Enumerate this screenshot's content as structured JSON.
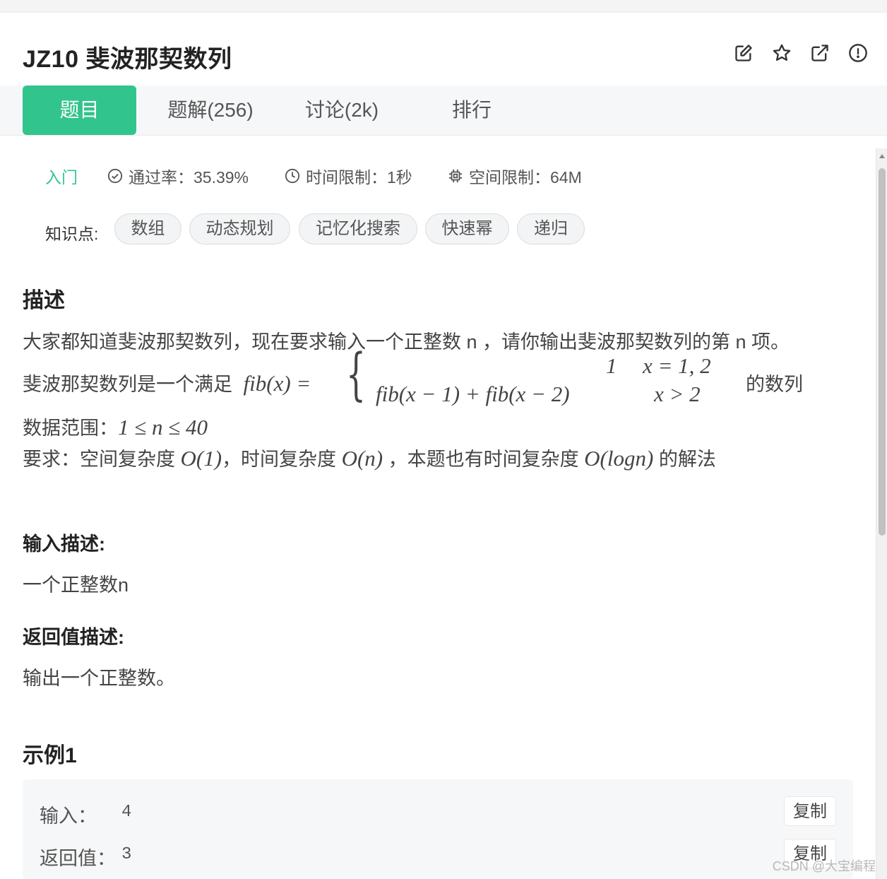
{
  "header": {
    "title": "JZ10  斐波那契数列",
    "icons": [
      "edit-icon",
      "star-icon",
      "share-icon",
      "report-icon"
    ]
  },
  "tabs": [
    {
      "label": "题目",
      "active": true
    },
    {
      "label": "题解(256)",
      "active": false
    },
    {
      "label": "讨论(2k)",
      "active": false
    },
    {
      "label": "排行",
      "active": false
    }
  ],
  "meta": {
    "level": "入门",
    "pass_rate": "通过率：35.39%",
    "time_limit": "时间限制：1秒",
    "space_limit": "空间限制：64M"
  },
  "knowledge": {
    "label": "知识点:",
    "tags": [
      "数组",
      "动态规划",
      "记忆化搜索",
      "快速幂",
      "递归"
    ]
  },
  "description": {
    "heading": "描述",
    "line1": "大家都知道斐波那契数列，现在要求输入一个正整数 n ，请你输出斐波那契数列的第 n 项。",
    "line2_prefix": "斐波那契数列是一个满足",
    "line2_fx": "fib(x) =",
    "case1_value": "1",
    "case1_cond": "x = 1, 2",
    "case2_value": "fib(x − 1) + fib(x − 2)",
    "case2_cond": "x > 2",
    "line2_suffix": "的数列",
    "line3_prefix": "数据范围：",
    "line3_math": "1 ≤ n ≤ 40",
    "line4_prefix": "要求：空间复杂度",
    "line4_m1": "O(1)",
    "line4_mid": "，时间复杂度",
    "line4_m2": "O(n)",
    "line4_mid2": "，本题也有时间复杂度",
    "line4_m3": "O(logn)",
    "line4_suffix": "的解法"
  },
  "input": {
    "heading": "输入描述:",
    "text": "一个正整数n"
  },
  "output": {
    "heading": "返回值描述:",
    "text": "输出一个正整数。"
  },
  "example": {
    "heading": "示例1",
    "input_label": "输入：",
    "input_value": "4",
    "output_label": "返回值：",
    "output_value": "3",
    "copy_label": "复制"
  },
  "watermark": "CSDN @大宝编程",
  "colors": {
    "accent": "#32c48d"
  }
}
